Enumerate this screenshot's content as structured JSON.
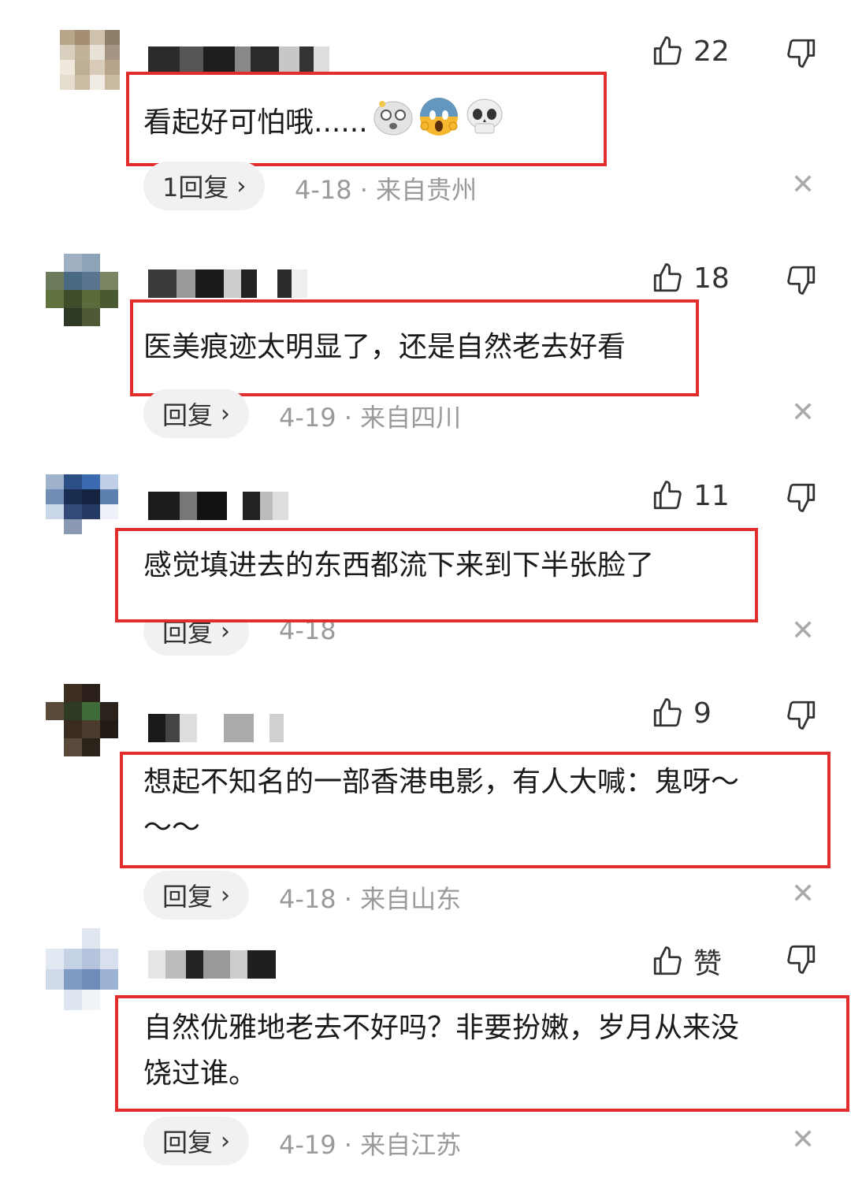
{
  "comments": [
    {
      "like_count": "22",
      "text": "看起好可怕哦......",
      "emojis": [
        "dizzy-face-emoji",
        "screaming-face-emoji",
        "skull-emoji"
      ],
      "reply_label": "1回复",
      "date": "4-18",
      "location": "· 来自贵州"
    },
    {
      "like_count": "18",
      "text": "医美痕迹太明显了，还是自然老去好看",
      "reply_label": "回复",
      "date": "4-19",
      "location": "· 来自四川"
    },
    {
      "like_count": "11",
      "text": "感觉填进去的东西都流下来到下半张脸了",
      "reply_label": "回复",
      "date": "4-18",
      "location": ""
    },
    {
      "like_count": "9",
      "text_line1": "想起不知名的一部香港电影，有人大喊：鬼呀～",
      "text_line2": "～～",
      "reply_label": "回复",
      "date": "4-18",
      "location": "· 来自山东"
    },
    {
      "like_count": "赞",
      "text_line1": "自然优雅地老去不好吗？非要扮嫩，岁月从来没",
      "text_line2": "饶过谁。",
      "reply_label": "回复",
      "date": "4-19",
      "location": "· 来自江苏"
    }
  ],
  "icons": {
    "like": "thumbs-up-icon",
    "dislike": "thumbs-down-icon",
    "close": "close-icon",
    "chevron": "chevron-right-icon"
  },
  "colors": {
    "highlight_box": "#e32d2d",
    "pill_bg": "#f1f1f3",
    "meta_text": "#9a9a9a"
  }
}
